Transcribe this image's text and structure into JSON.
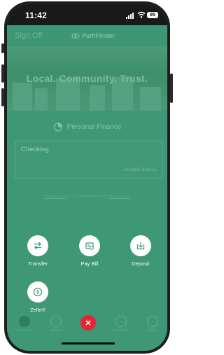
{
  "status": {
    "time": "11:42",
    "battery": "95"
  },
  "header": {
    "sign_off": "Sign Off",
    "brand": "PathFinder"
  },
  "hero": {
    "tagline": "Local. Community. Trust."
  },
  "section": {
    "title": "Personal Finance"
  },
  "account": {
    "name": "Checking",
    "balance_label": "Available Balance"
  },
  "footer": {
    "mobile_privacy": "Mobile Privacy",
    "middle": "© 2023 PathFinder Bank |",
    "privacy_policy": "Privacy Policy"
  },
  "actions": [
    {
      "label": "Transfer",
      "icon": "transfer-icon"
    },
    {
      "label": "Pay Bill",
      "icon": "pay-bill-icon"
    },
    {
      "label": "Deposit",
      "icon": "deposit-icon"
    },
    {
      "label": "Zelle®",
      "icon": "zelle-icon"
    }
  ],
  "tabs": [
    {
      "label": "Accounts"
    },
    {
      "label": "Deposit"
    },
    {
      "label": "Locations"
    },
    {
      "label": "More"
    }
  ],
  "colors": {
    "overlay": "#3e9775",
    "close": "#e52535",
    "frame": "#1e1e1e"
  }
}
